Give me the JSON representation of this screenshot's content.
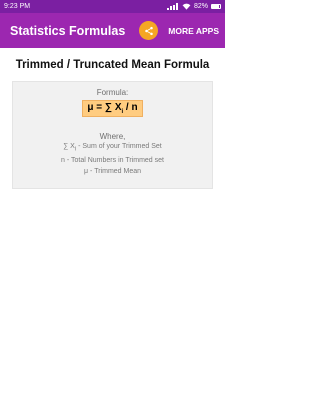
{
  "status_bar": {
    "time": "9:23 PM",
    "battery": "82%"
  },
  "app_bar": {
    "title": "Statistics Formulas",
    "more_apps": "MORE APPS",
    "share_icon": "share-icon"
  },
  "page_title": "Trimmed / Truncated Mean Formula",
  "formula": {
    "label": "Formula:",
    "lhs": "μ = ∑ X",
    "sub": "i",
    "rhs": " / n"
  },
  "where": {
    "label": "Where,",
    "lines": [
      {
        "symbol": "∑ X",
        "sub": "i",
        "text": " - Sum of your Trimmed Set"
      },
      {
        "text": "n - Total Numbers in Trimmed set"
      },
      {
        "text": "μ - Trimmed Mean"
      }
    ]
  },
  "colors": {
    "status_bar": "#7b1fa2",
    "app_bar": "#9c27b0",
    "share_button": "#f5a623",
    "formula_highlight": "#ffcc80",
    "card_bg": "#f1f1f1"
  }
}
